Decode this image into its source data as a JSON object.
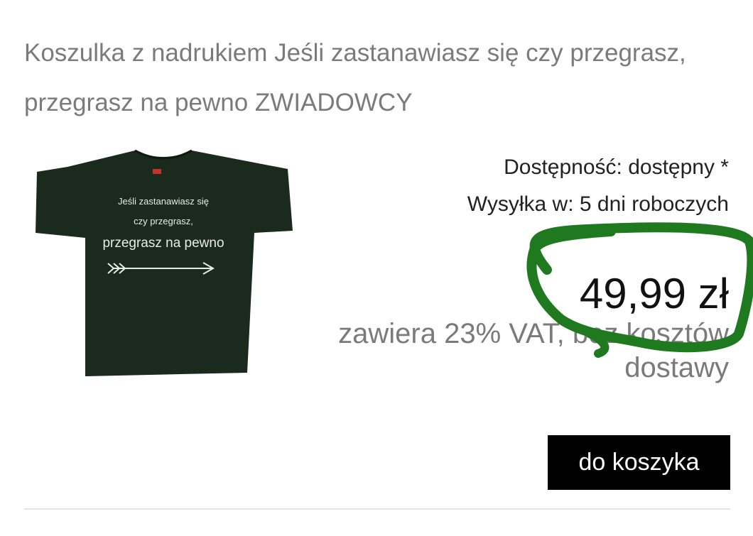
{
  "product": {
    "title": "Koszulka z nadrukiem Jeśli zastanawiasz się czy przegrasz, przegrasz na pewno ZWIADOWCY",
    "image": {
      "description": "dark green t-shirt with white print",
      "print_lines": [
        "Jeśli zastanawiasz się",
        "czy przegrasz,",
        "przegrasz na pewno"
      ],
      "shirt_color": "#1a2a1c",
      "print_color": "#e8ece6"
    },
    "availability": "Dostępność: dostępny *",
    "shipping": "Wysyłka w: 5 dni roboczych",
    "price": "49,99 zł",
    "vat_note": "zawiera 23% VAT, bez kosztów dostawy"
  },
  "actions": {
    "add_to_cart_label": "do koszyka"
  },
  "annotation": {
    "color": "#1f7a1f",
    "shape": "hand-drawn-circle"
  }
}
